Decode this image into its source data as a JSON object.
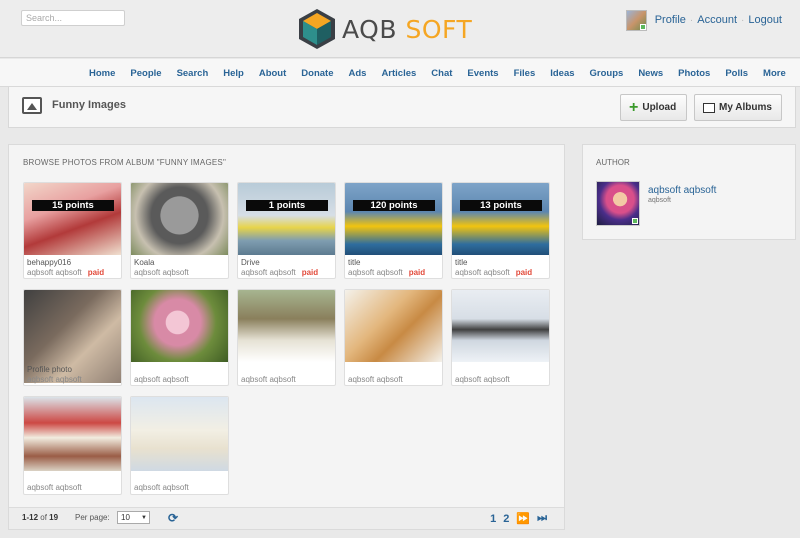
{
  "search": {
    "placeholder": "Search..."
  },
  "brand": {
    "part1": "AQB",
    "part2": "SOFT",
    "accent": "#f5a623"
  },
  "user_menu": [
    "Profile",
    "Account",
    "Logout"
  ],
  "nav": [
    "Home",
    "People",
    "Search",
    "Help",
    "About",
    "Donate",
    "Ads",
    "Articles",
    "Chat",
    "Events",
    "Files",
    "Ideas",
    "Groups",
    "News",
    "Photos",
    "Polls",
    "More"
  ],
  "album": {
    "title": "Funny Images",
    "upload_label": "Upload",
    "albums_label": "My Albums",
    "heading": "BROWSE PHOTOS FROM ALBUM \"FUNNY IMAGES\""
  },
  "photos": [
    {
      "points": "15 points",
      "title": "behappy016",
      "owner": "aqbsoft aqbsoft",
      "paid": "paid",
      "icon": "painted-figure"
    },
    {
      "points": "",
      "title": "Koala",
      "owner": "aqbsoft aqbsoft",
      "paid": "",
      "icon": "koala"
    },
    {
      "points": "1 points",
      "title": "Drive",
      "owner": "aqbsoft aqbsoft",
      "paid": "paid",
      "icon": "jetski"
    },
    {
      "points": "120 points",
      "title": "title",
      "owner": "aqbsoft aqbsoft",
      "paid": "paid",
      "icon": "banana-boat"
    },
    {
      "points": "13 points",
      "title": "title",
      "owner": "aqbsoft aqbsoft",
      "paid": "paid",
      "icon": "banana-boat"
    },
    {
      "points": "",
      "title": "Profile photo",
      "owner": "aqbsoft aqbsoft",
      "paid": "",
      "icon": "man-in-hat"
    },
    {
      "points": "",
      "title": "",
      "owner": "aqbsoft aqbsoft",
      "paid": "",
      "icon": "pug"
    },
    {
      "points": "",
      "title": "",
      "owner": "aqbsoft aqbsoft",
      "paid": "",
      "icon": "dogs"
    },
    {
      "points": "",
      "title": "",
      "owner": "aqbsoft aqbsoft",
      "paid": "",
      "icon": "cat-mirror"
    },
    {
      "points": "",
      "title": "",
      "owner": "aqbsoft aqbsoft",
      "paid": "",
      "icon": "cats-snow"
    },
    {
      "points": "",
      "title": "",
      "owner": "aqbsoft aqbsoft",
      "paid": "",
      "icon": "fridge"
    },
    {
      "points": "",
      "title": "",
      "owner": "aqbsoft aqbsoft",
      "paid": "",
      "icon": "polar-bears"
    }
  ],
  "pager": {
    "range": "1-12",
    "of_label": "of",
    "total": "19",
    "per_page_label": "Per page:",
    "per_page_value": "10",
    "pages": [
      "1",
      "2"
    ],
    "next": "⏩",
    "last": "⏭"
  },
  "author": {
    "heading": "AUTHOR",
    "name": "aqbsoft aqbsoft",
    "username": "aqbsoft"
  }
}
